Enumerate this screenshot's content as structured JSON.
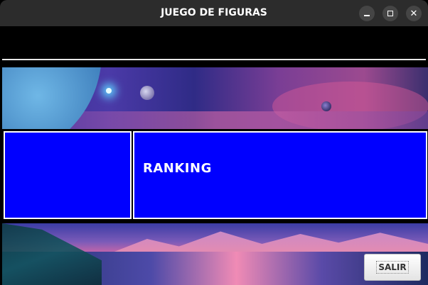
{
  "window": {
    "title": "JUEGO DE FIGURAS",
    "controls": {
      "minimize_icon": "minimize-icon",
      "maximize_icon": "maximize-icon",
      "close_icon": "close-icon",
      "close_glyph": "✕"
    }
  },
  "panel": {
    "heading": "RANKING",
    "background_color": "#0000ff"
  },
  "footer": {
    "exit_label": "SALIR"
  },
  "colors": {
    "titlebar": "#2c2c2c",
    "accent_blue": "#0000ff",
    "background": "#000000"
  }
}
